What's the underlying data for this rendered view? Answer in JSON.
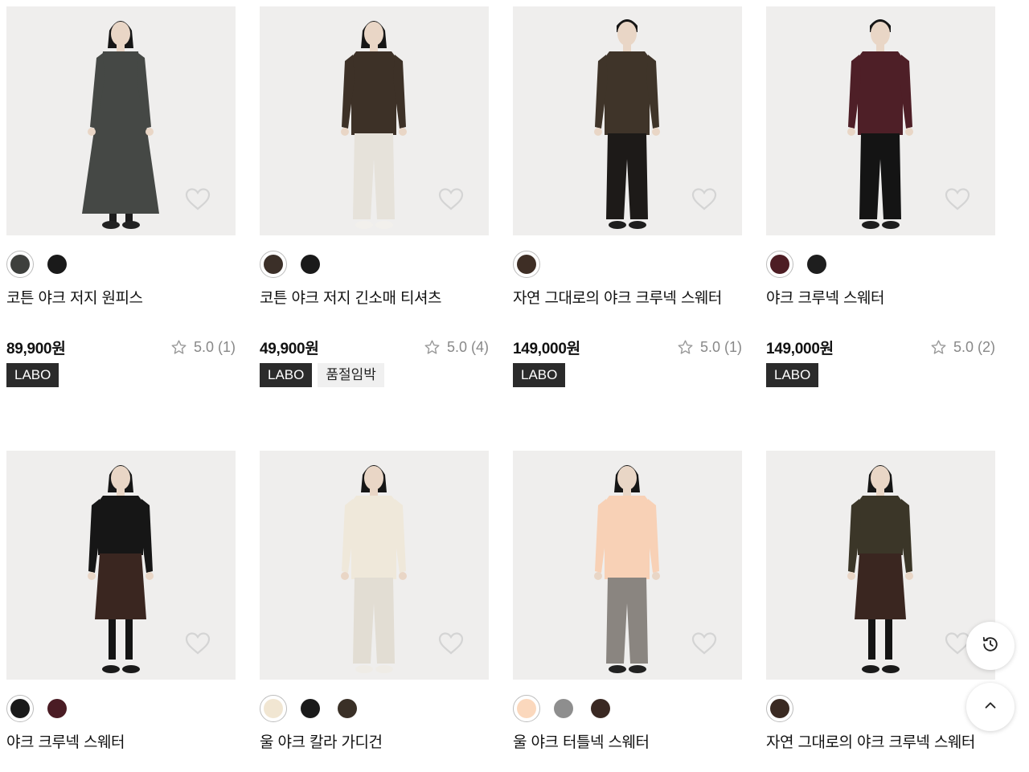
{
  "products": [
    {
      "name": "코튼 야크 저지 원피스",
      "price": "89,900원",
      "rating": "5.0",
      "review_count": "(1)",
      "badges": [
        {
          "label": "LABO",
          "style": "dark"
        }
      ],
      "colors": [
        "#3e403d",
        "#1a1a1a"
      ],
      "selected_color": 0,
      "figure": {
        "top": "#454845",
        "bottom": "#454845",
        "dress": true,
        "gender": "f",
        "shoes": "#222"
      }
    },
    {
      "name": "코튼 야크 저지 긴소매 티셔츠",
      "price": "49,900원",
      "rating": "5.0",
      "review_count": "(4)",
      "badges": [
        {
          "label": "LABO",
          "style": "dark"
        },
        {
          "label": "품절임박",
          "style": "light"
        }
      ],
      "colors": [
        "#3b2f28",
        "#1a1a1a"
      ],
      "selected_color": 0,
      "figure": {
        "top": "#3d3127",
        "bottom": "#e6e2da",
        "dress": false,
        "gender": "f",
        "shoes": "#f2f0ec"
      }
    },
    {
      "name": "자연 그대로의 야크 크루넥 스웨터",
      "price": "149,000원",
      "rating": "5.0",
      "review_count": "(1)",
      "badges": [
        {
          "label": "LABO",
          "style": "dark"
        }
      ],
      "colors": [
        "#3e2e25"
      ],
      "selected_color": 0,
      "figure": {
        "top": "#3f3429",
        "bottom": "#1d1a18",
        "dress": false,
        "gender": "m",
        "shoes": "#1e1e1e"
      }
    },
    {
      "name": "야크 크루넥 스웨터",
      "price": "149,000원",
      "rating": "5.0",
      "review_count": "(2)",
      "badges": [
        {
          "label": "LABO",
          "style": "dark"
        }
      ],
      "colors": [
        "#4d1d24",
        "#1e1e1e"
      ],
      "selected_color": 0,
      "figure": {
        "top": "#4e1f27",
        "bottom": "#141414",
        "dress": false,
        "gender": "m",
        "shoes": "#1e1e1e"
      }
    },
    {
      "name": "야크 크루넥 스웨터",
      "colors": [
        "#1a1a1a",
        "#4a1c24"
      ],
      "selected_color": 0,
      "figure": {
        "top": "#161616",
        "bottom": "#3a2620",
        "dress": true,
        "gender": "f",
        "shoes": "#1a1a1a",
        "skirt": true
      }
    },
    {
      "name": "울 야크 칼라 가디건",
      "colors": [
        "#f1e6d2",
        "#1a1a1a",
        "#3a3027"
      ],
      "selected_color": 0,
      "figure": {
        "top": "#efe8da",
        "bottom": "#e2ddd3",
        "dress": false,
        "gender": "f",
        "shoes": "#efece6"
      }
    },
    {
      "name": "울 야크 터틀넥 스웨터",
      "colors": [
        "#fbd8bd",
        "#8e8e8e",
        "#3a2923"
      ],
      "selected_color": 0,
      "figure": {
        "top": "#f8d1b6",
        "bottom": "#8a8580",
        "dress": false,
        "gender": "f",
        "shoes": "#222"
      }
    },
    {
      "name": "자연 그대로의 야크 크루넥 스웨터",
      "colors": [
        "#3a2a22"
      ],
      "selected_color": 0,
      "figure": {
        "top": "#3b3628",
        "bottom": "#3a2620",
        "dress": true,
        "gender": "f",
        "shoes": "#1a1a1a",
        "skirt": true
      }
    }
  ],
  "floating_buttons": {
    "history_icon": "history-icon",
    "top_icon": "chevron-up-icon"
  }
}
